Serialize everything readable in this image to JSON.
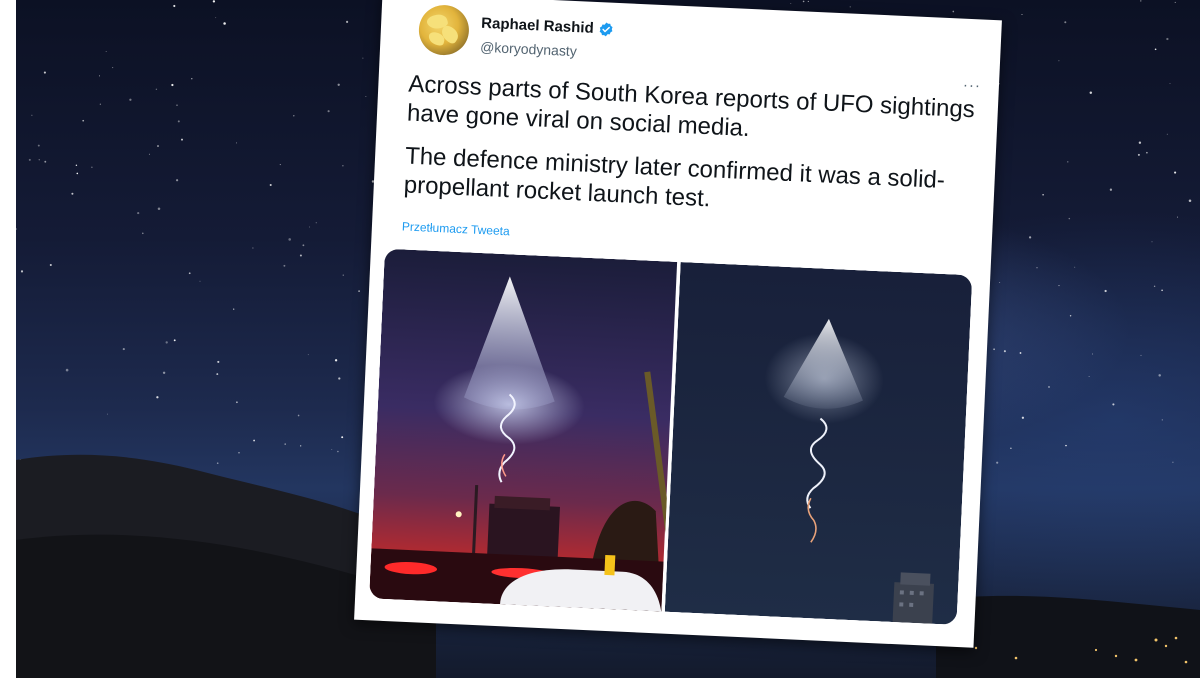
{
  "tweet": {
    "author_name": "Raphael Rashid",
    "author_handle": "@koryodynasty",
    "verified": true,
    "more_label": "···",
    "paragraphs": [
      "Across parts of South Korea reports of UFO sightings have gone viral on social media.",
      "The defence ministry later confirmed it was a solid-propellant rocket launch test."
    ],
    "translate_label": "Przetłumacz Tweeta"
  },
  "colors": {
    "link": "#1d9bf0",
    "verified": "#1d9bf0",
    "text": "#0f1419",
    "muted": "#536471"
  },
  "icons": {
    "verified": "verified-badge-icon",
    "more": "more-horizontal-icon"
  }
}
